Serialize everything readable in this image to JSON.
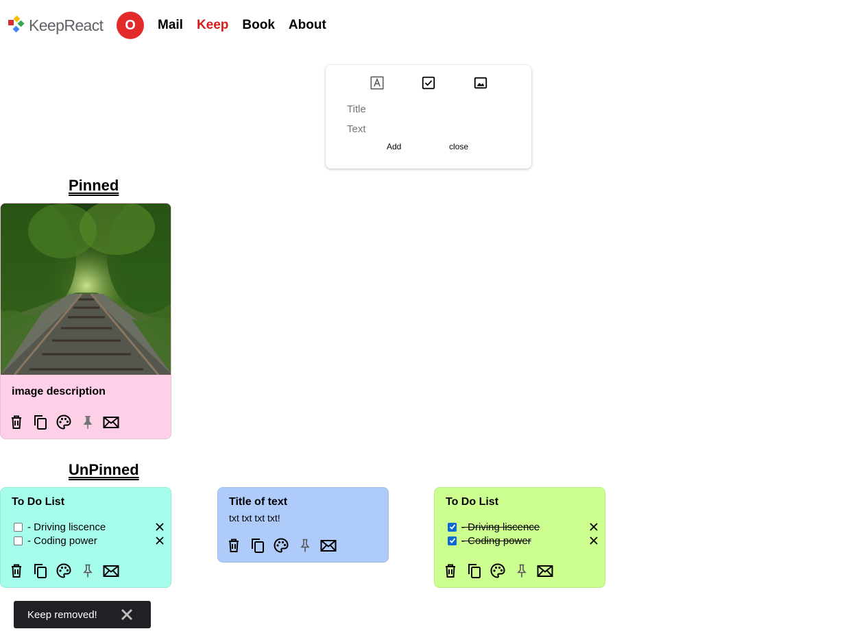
{
  "header": {
    "logo_text": "KeepReact",
    "avatar_letter": "O",
    "nav": [
      {
        "label": "Mail",
        "active": false
      },
      {
        "label": "Keep",
        "active": true
      },
      {
        "label": "Book",
        "active": false
      },
      {
        "label": "About",
        "active": false
      }
    ]
  },
  "composer": {
    "type_icons": [
      "text-note-icon",
      "checklist-icon",
      "image-icon"
    ],
    "title_placeholder": "Title",
    "text_placeholder": "Text",
    "add_label": "Add",
    "close_label": "close"
  },
  "pinned": {
    "heading": "Pinned",
    "notes": [
      {
        "type": "image",
        "title": "image description",
        "color": "#fdd0e8",
        "image_subject": "railway track through green forest"
      }
    ]
  },
  "unpinned": {
    "heading": "UnPinned",
    "notes": [
      {
        "type": "todo",
        "title": "To Do List",
        "color": "#a7fdeb",
        "items": [
          {
            "text": "- Driving liscence",
            "done": false
          },
          {
            "text": "- Coding power",
            "done": false
          }
        ]
      },
      {
        "type": "text",
        "title": "Title of text",
        "text": "txt txt txt txt!",
        "color": "#aecbfa"
      },
      {
        "type": "todo",
        "title": "To Do List",
        "color": "#ccff90",
        "items": [
          {
            "text": "- Driving liscence",
            "done": true
          },
          {
            "text": "- Coding power",
            "done": true
          }
        ]
      }
    ]
  },
  "note_tools": [
    "trash-icon",
    "duplicate-icon",
    "palette-icon",
    "pin-icon",
    "mail-icon"
  ],
  "toast": {
    "message": "Keep removed!"
  }
}
